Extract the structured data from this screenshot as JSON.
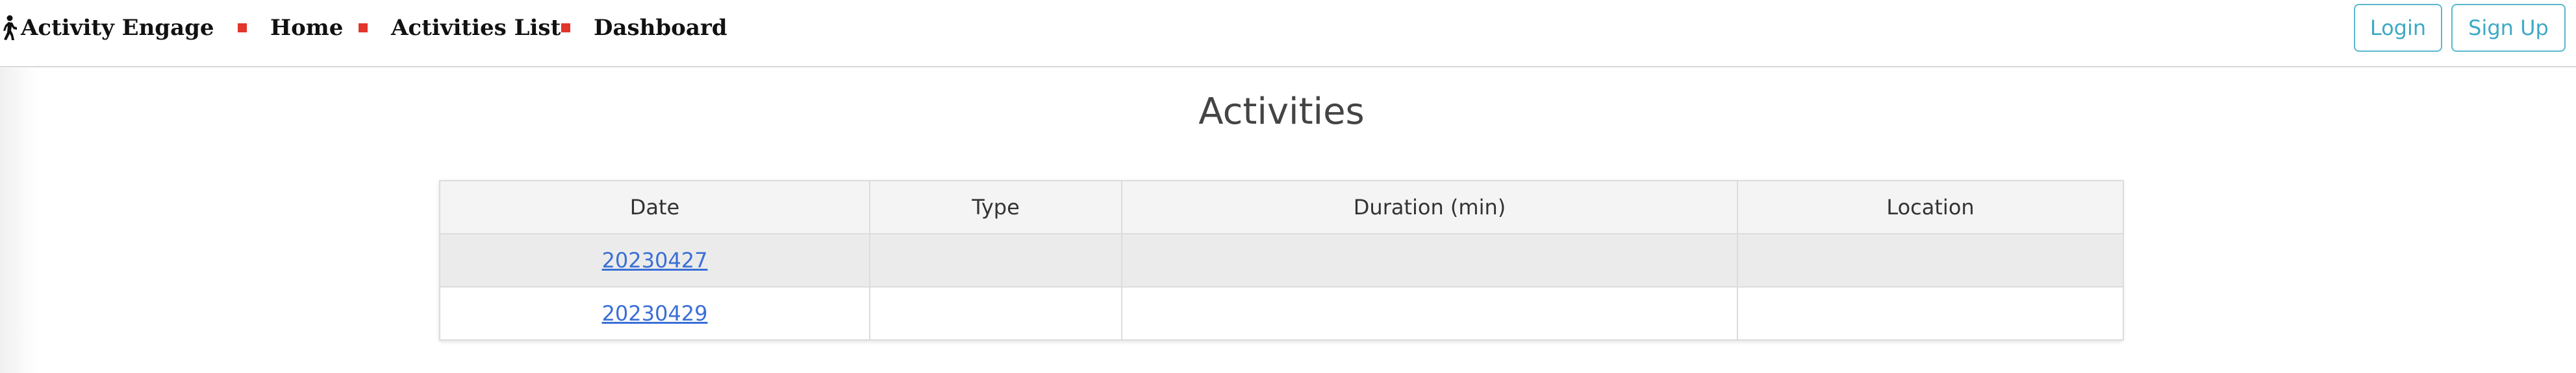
{
  "navbar": {
    "brand": "Activity Engage",
    "brand_icon": "walking-person-icon",
    "items": [
      {
        "label": "Home"
      },
      {
        "label": "Activities List"
      },
      {
        "label": "Dashboard"
      }
    ],
    "bullet_color": "#e2352b",
    "login_label": "Login",
    "signup_label": "Sign Up",
    "accent_color": "#3ea9c6"
  },
  "main": {
    "title": "Activities",
    "table": {
      "headers": [
        "Date",
        "Type",
        "Duration (min)",
        "Location"
      ],
      "rows": [
        {
          "date": "20230427",
          "type": "",
          "duration": "",
          "location": ""
        },
        {
          "date": "20230429",
          "type": "",
          "duration": "",
          "location": ""
        }
      ]
    },
    "link_color": "#3a6fd6"
  }
}
